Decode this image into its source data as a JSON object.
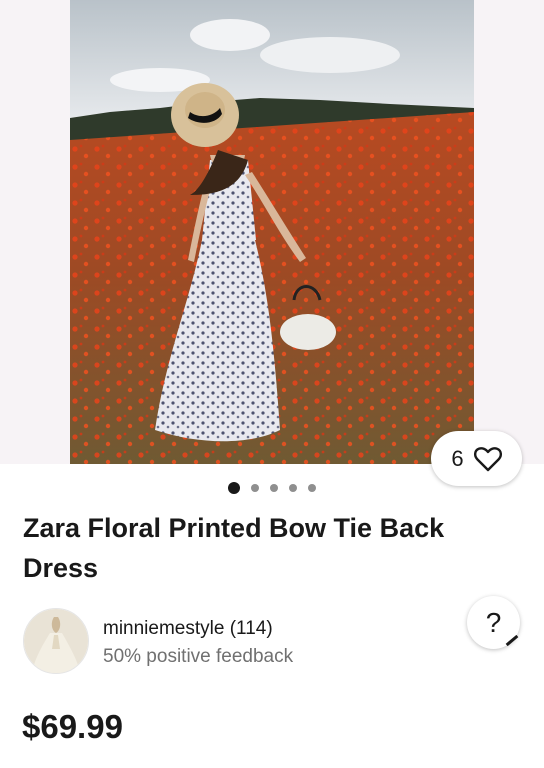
{
  "listing": {
    "title": "Zara Floral Printed Bow Tie Back Dress",
    "price": "$69.99",
    "like_count": "6",
    "image_count": 5,
    "active_image_index": 1
  },
  "seller": {
    "name_line": "minniemestyle (114)",
    "feedback": "50% positive feedback"
  },
  "help": {
    "symbol": "?"
  },
  "icons": {
    "like": "heart-outline-icon",
    "help": "question-icon"
  },
  "colors": {
    "text": "#191919",
    "secondary": "#707070",
    "dot_inactive": "#8f8f8f",
    "hero_bg": "#f7f3f6"
  }
}
